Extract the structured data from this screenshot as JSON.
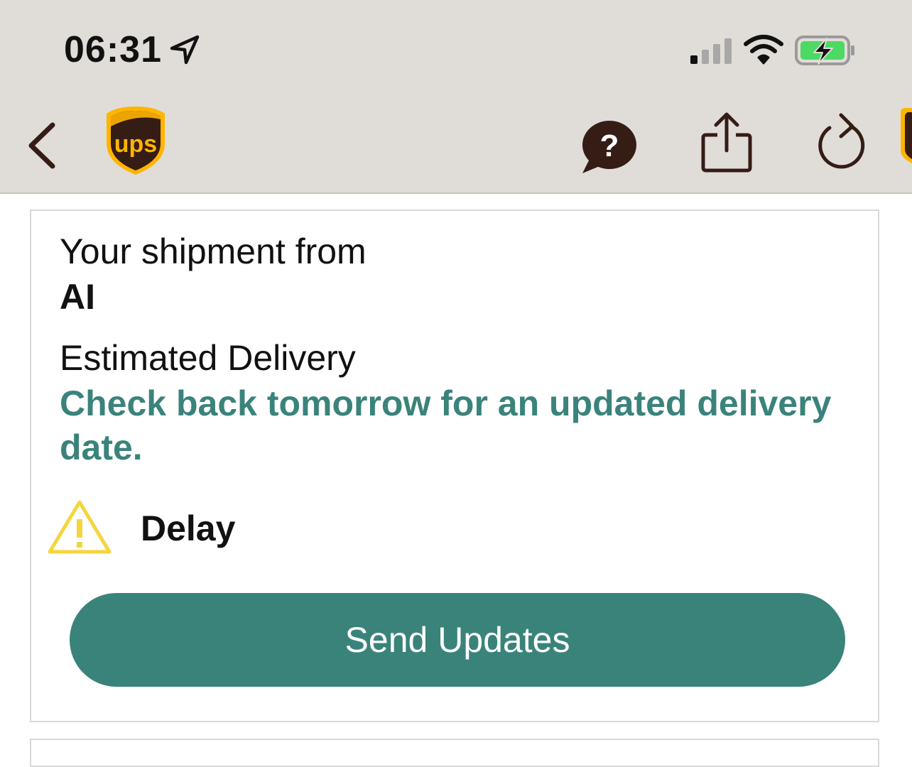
{
  "status_bar": {
    "time": "06:31",
    "icons": [
      "location-arrow-icon",
      "cellular-signal-icon",
      "wifi-icon",
      "battery-charging-icon"
    ]
  },
  "nav_bar": {
    "brand": "ups",
    "icons": [
      "back-chevron-icon",
      "ups-logo",
      "help-chat-icon",
      "share-icon",
      "refresh-icon"
    ]
  },
  "shipment": {
    "from_label": "Your shipment from",
    "sender": "AI",
    "estimated_label": "Estimated Delivery",
    "estimated_value": "Check back tomorrow for an updated delivery date.",
    "status": "Delay",
    "status_icon": "warning-triangle-icon",
    "send_updates_label": "Send Updates"
  },
  "colors": {
    "header_bg": "#e0ddd8",
    "accent_teal": "#3a837b",
    "ups_brown": "#351c15",
    "ups_gold": "#ffb500",
    "warning_yellow": "#f4d63c",
    "battery_green": "#4cd964"
  }
}
